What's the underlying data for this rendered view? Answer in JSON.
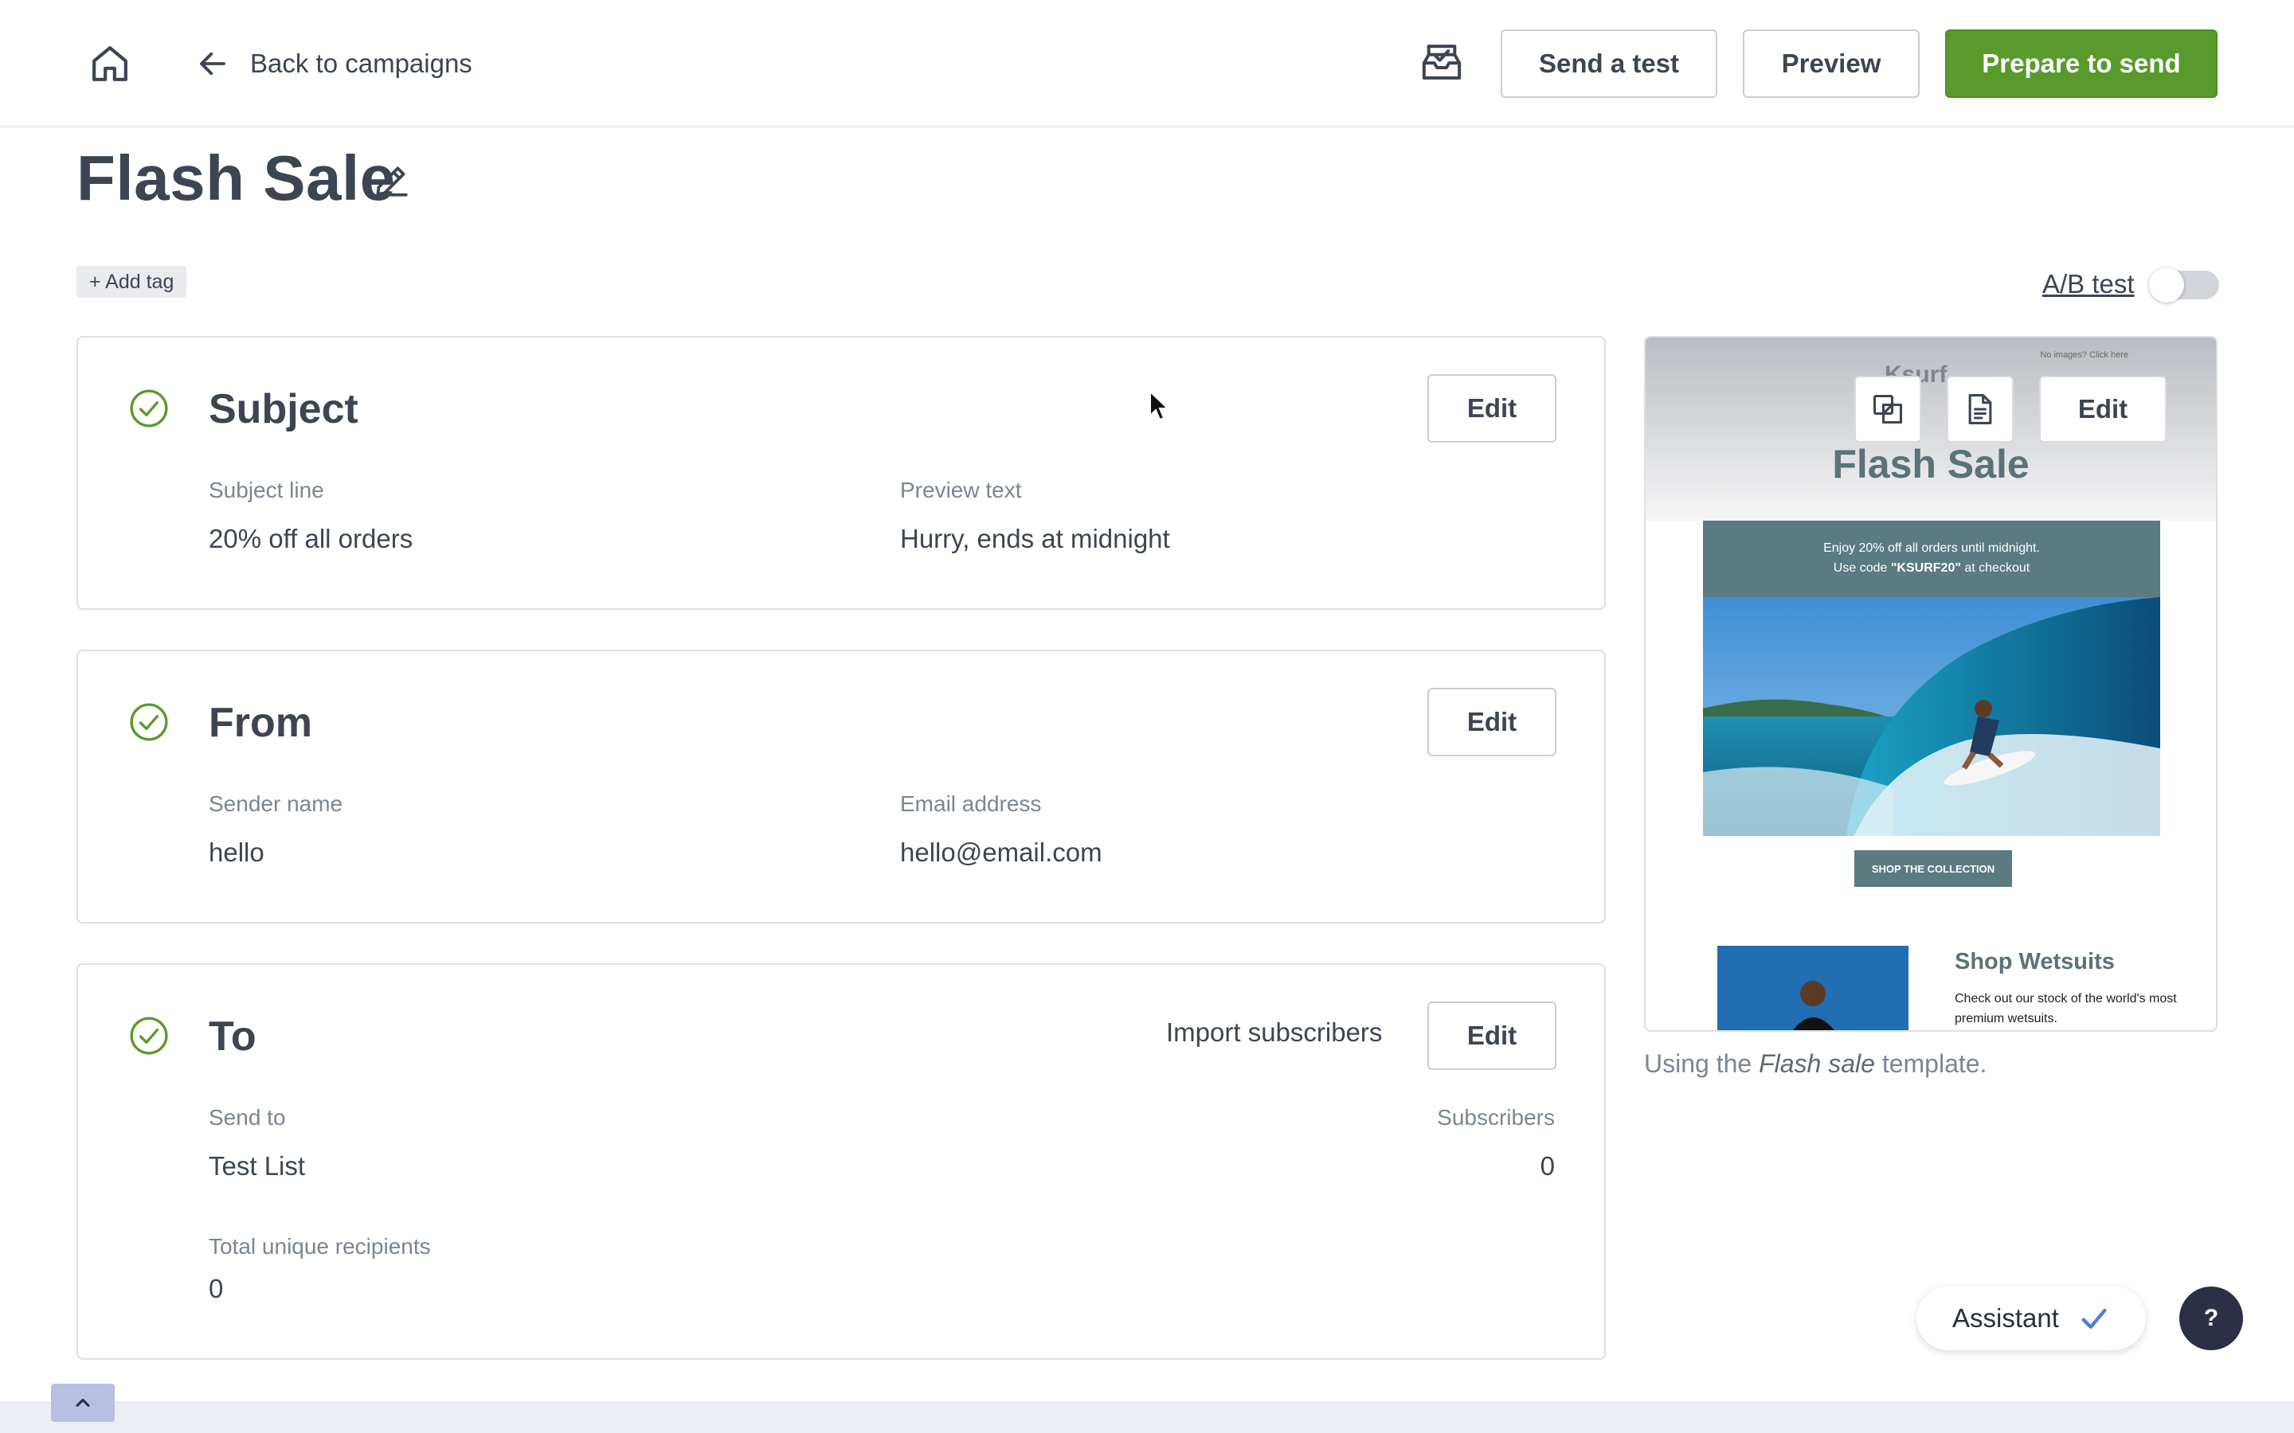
{
  "topbar": {
    "back_label": "Back to campaigns",
    "send_test_label": "Send a test",
    "preview_label": "Preview",
    "prepare_label": "Prepare to send",
    "primary_color": "#5a9a2c"
  },
  "campaign": {
    "title": "Flash Sale",
    "add_tag_label": "+ Add tag",
    "ab_test_label": "A/B test",
    "ab_test_enabled": false
  },
  "subject": {
    "title": "Subject",
    "edit_label": "Edit",
    "subject_line_label": "Subject line",
    "subject_line_value": "20% off all orders",
    "preview_text_label": "Preview text",
    "preview_text_value": "Hurry, ends at midnight"
  },
  "from": {
    "title": "From",
    "edit_label": "Edit",
    "sender_name_label": "Sender name",
    "sender_name_value": "hello",
    "email_label": "Email address",
    "email_value": "hello@email.com"
  },
  "to": {
    "title": "To",
    "import_label": "Import subscribers",
    "edit_label": "Edit",
    "send_to_label": "Send to",
    "send_to_value": "Test List",
    "subscribers_label": "Subscribers",
    "subscribers_value": "0",
    "total_label": "Total unique recipients",
    "total_value": "0"
  },
  "email_preview": {
    "brand": "Ksurf",
    "no_images_text": "No images? Click here",
    "heading": "Flash Sale",
    "banner_line1": "Enjoy 20% off all orders until midnight.",
    "banner_line2_prefix": "Use code ",
    "banner_code": "\"KSURF20\"",
    "banner_line2_suffix": " at checkout",
    "shop_button": "SHOP THE COLLECTION",
    "shop_title": "Shop Wetsuits",
    "shop_text": "Check out our stock of the world's most premium wetsuits.",
    "edit_label": "Edit"
  },
  "template_note": {
    "prefix": "Using the ",
    "template_name": "Flash sale",
    "suffix": " template."
  },
  "assistant": {
    "label": "Assistant"
  },
  "help": {
    "label": "?"
  }
}
